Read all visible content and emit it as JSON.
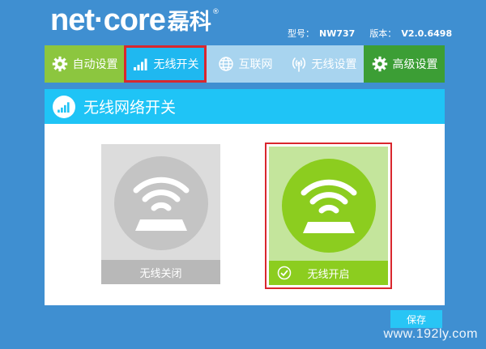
{
  "brand": {
    "logo_main": "net·core",
    "logo_cn": "磊科",
    "registered_mark": "®"
  },
  "model_info": {
    "model_label": "型号：",
    "model_value": "NW737",
    "version_label": "版本：",
    "version_value": "V2.0.6498"
  },
  "tabs": [
    {
      "label": "自动设置",
      "icon": "gear-icon",
      "active": false
    },
    {
      "label": "无线开关",
      "icon": "signal-bars-icon",
      "active": true
    },
    {
      "label": "互联网",
      "icon": "globe-icon",
      "active": false
    },
    {
      "label": "无线设置",
      "icon": "wireless-antenna-icon",
      "active": false
    },
    {
      "label": "高级设置",
      "icon": "gear-icon",
      "active": false
    }
  ],
  "panel": {
    "title": "无线网络开关",
    "options": [
      {
        "label": "无线关闭",
        "state": "off",
        "selected": false
      },
      {
        "label": "无线开启",
        "state": "on",
        "selected": true
      }
    ]
  },
  "actions": {
    "save_label": "保存"
  },
  "watermark": "www.192ly.com",
  "colors": {
    "background": "#3f8fd1",
    "tab_green": "#8cc63f",
    "tab_active": "#1fb8f0",
    "tab_inactive": "#a8d4ef",
    "tab_dark_green": "#3c9e35",
    "highlight_red": "#d9272e",
    "wifi_on_green": "#8ccd1f",
    "wifi_off_gray": "#c4c4c4"
  }
}
